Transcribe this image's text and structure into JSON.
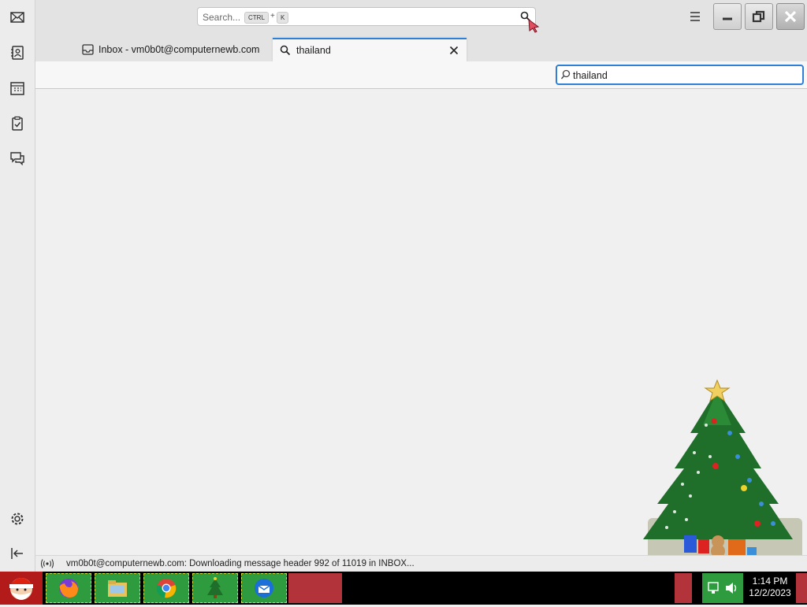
{
  "search": {
    "placeholder": "Search...",
    "key1": "CTRL",
    "plus": "+",
    "key2": "K"
  },
  "tabs": [
    {
      "label": "Inbox - vm0b0t@computernewb.com"
    },
    {
      "label": "thailand"
    }
  ],
  "quick_filter": {
    "value": "thailand"
  },
  "status": {
    "text": "vm0b0t@computernewb.com: Downloading message header 992 of 11019 in INBOX..."
  },
  "clock": {
    "time": "1:14 PM",
    "date": "12/2/2023"
  },
  "colors": {
    "accent": "#2e7fd8",
    "taskbar_green": "#2e9b3e",
    "taskbar_red": "#b3333a"
  }
}
